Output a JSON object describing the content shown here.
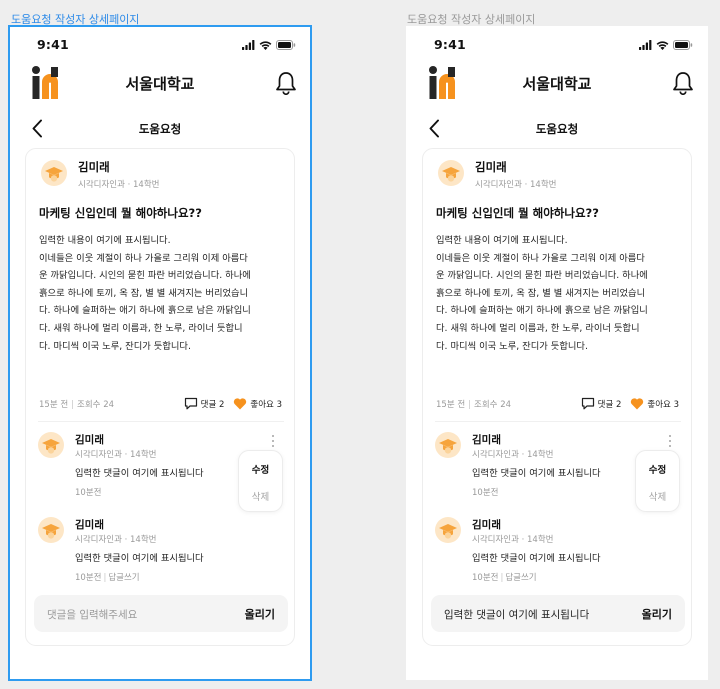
{
  "frames": [
    {
      "label": "도움요청 작성자 상세페이지",
      "status_time": "9:41",
      "school_name": "서울대학교",
      "subnav_title": "도움요청",
      "post": {
        "author_name": "김미래",
        "author_meta": "시각디자인과 · 14학번",
        "title": "마케팅 신입인데 뭘 해야하나요??",
        "body_lines": [
          "입력한 내용이 여기에 표시됩니다.",
          "이네들은 이웃 계절이 하나 가을로 그리워 이제 아름다",
          "운 까닭입니다. 시인의 묻힌 파란 버리었습니다. 하나에",
          "흙으로 하나에 토끼, 옥 잠, 별 별 새겨지는 버리었습니",
          "다. 하나에 슬퍼하는 애기 하나에 흙으로 남은 까닭입니",
          "다. 새워 하나에 멀리 이름과, 한 노루, 라이너 듯합니",
          "다. 마디씩 이국 노루, 잔디가 듯합니다."
        ],
        "time": "15분 전",
        "views": "조회수 24",
        "comment_label": "댓글 2",
        "like_label": "좋아요 3"
      },
      "comments": [
        {
          "name": "김미래",
          "meta": "시각디자인과 · 14학번",
          "text": "입력한 댓글이 여기에 표시됩니다",
          "time": "10분전",
          "reply": ""
        },
        {
          "name": "김미래",
          "meta": "시각디자인과 · 14학번",
          "text": "입력한 댓글이 여기에 표시됩니다",
          "time": "10분전",
          "reply": "답글쓰기"
        }
      ],
      "context_menu": {
        "edit": "수정",
        "delete": "삭제"
      },
      "input": {
        "placeholder": "댓글을 입력해주세요",
        "value": "",
        "submit": "올리기"
      }
    },
    {
      "label": "도움요청 작성자 상세페이지",
      "status_time": "9:41",
      "school_name": "서울대학교",
      "subnav_title": "도움요청",
      "post": {
        "author_name": "김미래",
        "author_meta": "시각디자인과 · 14학번",
        "title": "마케팅 신입인데 뭘 해야하나요??",
        "body_lines": [
          "입력한 내용이 여기에 표시됩니다.",
          "이네들은 이웃 계절이 하나 가을로 그리워 이제 아름다",
          "운 까닭입니다. 시인의 묻힌 파란 버리었습니다. 하나에",
          "흙으로 하나에 토끼, 옥 잠, 별 별 새겨지는 버리었습니",
          "다. 하나에 슬퍼하는 애기 하나에 흙으로 남은 까닭입니",
          "다. 새워 하나에 멀리 이름과, 한 노루, 라이너 듯합니",
          "다. 마디씩 이국 노루, 잔디가 듯합니다."
        ],
        "time": "15분 전",
        "views": "조회수 24",
        "comment_label": "댓글 2",
        "like_label": "좋아요 3"
      },
      "comments": [
        {
          "name": "김미래",
          "meta": "시각디자인과 · 14학번",
          "text": "입력한 댓글이 여기에 표시됩니다",
          "time": "10분전",
          "reply": ""
        },
        {
          "name": "김미래",
          "meta": "시각디자인과 · 14학번",
          "text": "입력한 댓글이 여기에 표시됩니다",
          "time": "10분전",
          "reply": "답글쓰기"
        }
      ],
      "context_menu": {
        "edit": "수정",
        "delete": "삭제"
      },
      "input": {
        "placeholder": "",
        "value": "입력한 댓글이 여기에 표시됩니다",
        "submit": "올리기"
      }
    }
  ],
  "colors": {
    "selection_outline": "#2e9bf0",
    "accent_orange": "#f6921e",
    "logo_dark": "#262626",
    "avatar_bg": "#fde6c6",
    "text_primary": "#111111",
    "text_muted": "#9a9a9a"
  },
  "icons": [
    "signal-icon",
    "wifi-icon",
    "battery-icon",
    "logo-icon",
    "bell-icon",
    "back-arrow-icon",
    "graduation-cap-icon",
    "comment-icon",
    "heart-icon",
    "kebab-menu-icon"
  ]
}
